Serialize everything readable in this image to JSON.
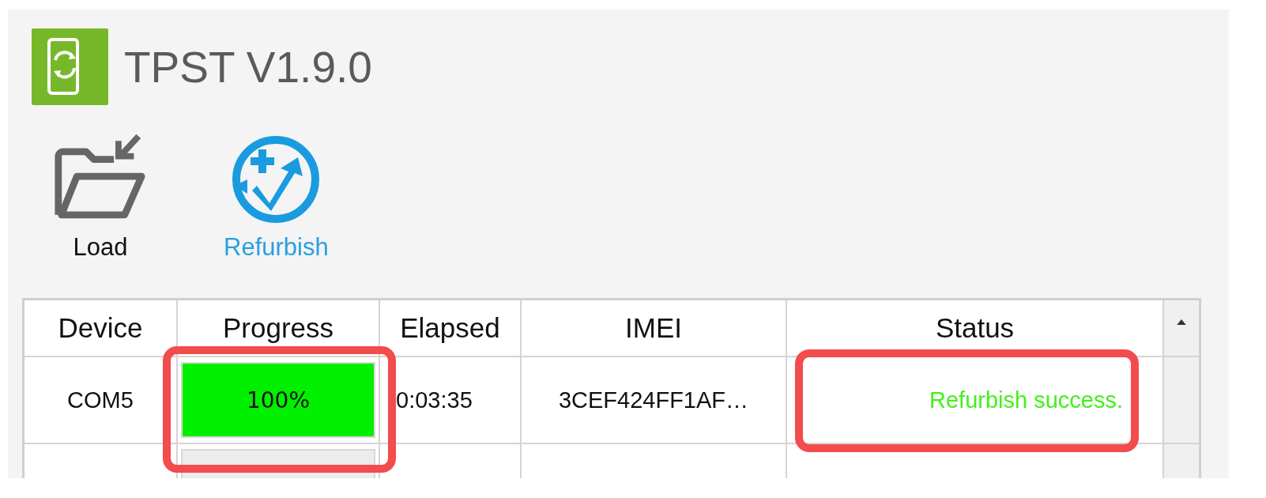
{
  "app": {
    "title": "TPST V1.9.0"
  },
  "toolbar": [
    {
      "kind": "load",
      "label": "Load"
    },
    {
      "kind": "refurbish",
      "label": "Refurbish"
    }
  ],
  "table": {
    "columns": [
      "Device",
      "Progress",
      "Elapsed",
      "IMEI",
      "Status"
    ],
    "rows": [
      {
        "device": "COM5",
        "progress": {
          "level": 1,
          "reading": "100%"
        },
        "elapsed": "0:03:35",
        "imei": "3CEF424FF1AF…",
        "status": "Refurbish success."
      },
      {
        "kind": "blank"
      }
    ]
  }
}
